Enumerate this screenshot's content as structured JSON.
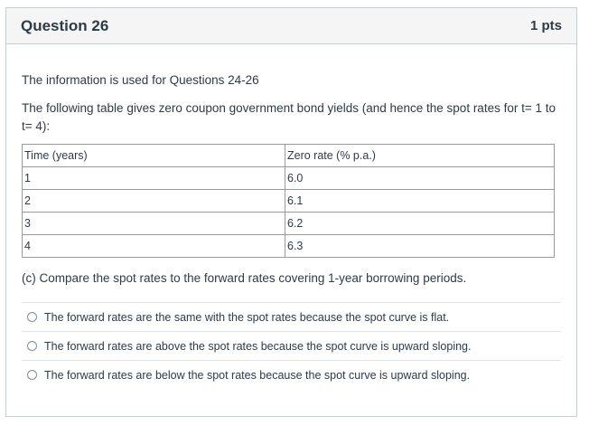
{
  "header": {
    "title": "Question 26",
    "points": "1 pts"
  },
  "body": {
    "intro": "The information is used for Questions 24-26",
    "description": "The following table gives zero coupon government bond yields (and hence the spot rates for t= 1 to t= 4):",
    "question": "(c) Compare the spot rates to the forward rates covering 1-year borrowing periods."
  },
  "table": {
    "headers": [
      "Time (years)",
      "Zero rate (% p.a.)"
    ],
    "rows": [
      [
        "1",
        "6.0"
      ],
      [
        "2",
        "6.1"
      ],
      [
        "3",
        "6.2"
      ],
      [
        "4",
        "6.3"
      ]
    ]
  },
  "answers": [
    "The forward rates are the same with the spot rates because the spot curve is flat.",
    "The forward rates are above the spot rates because the spot curve is upward sloping.",
    "The forward rates are below the spot rates because the spot curve is upward sloping."
  ]
}
